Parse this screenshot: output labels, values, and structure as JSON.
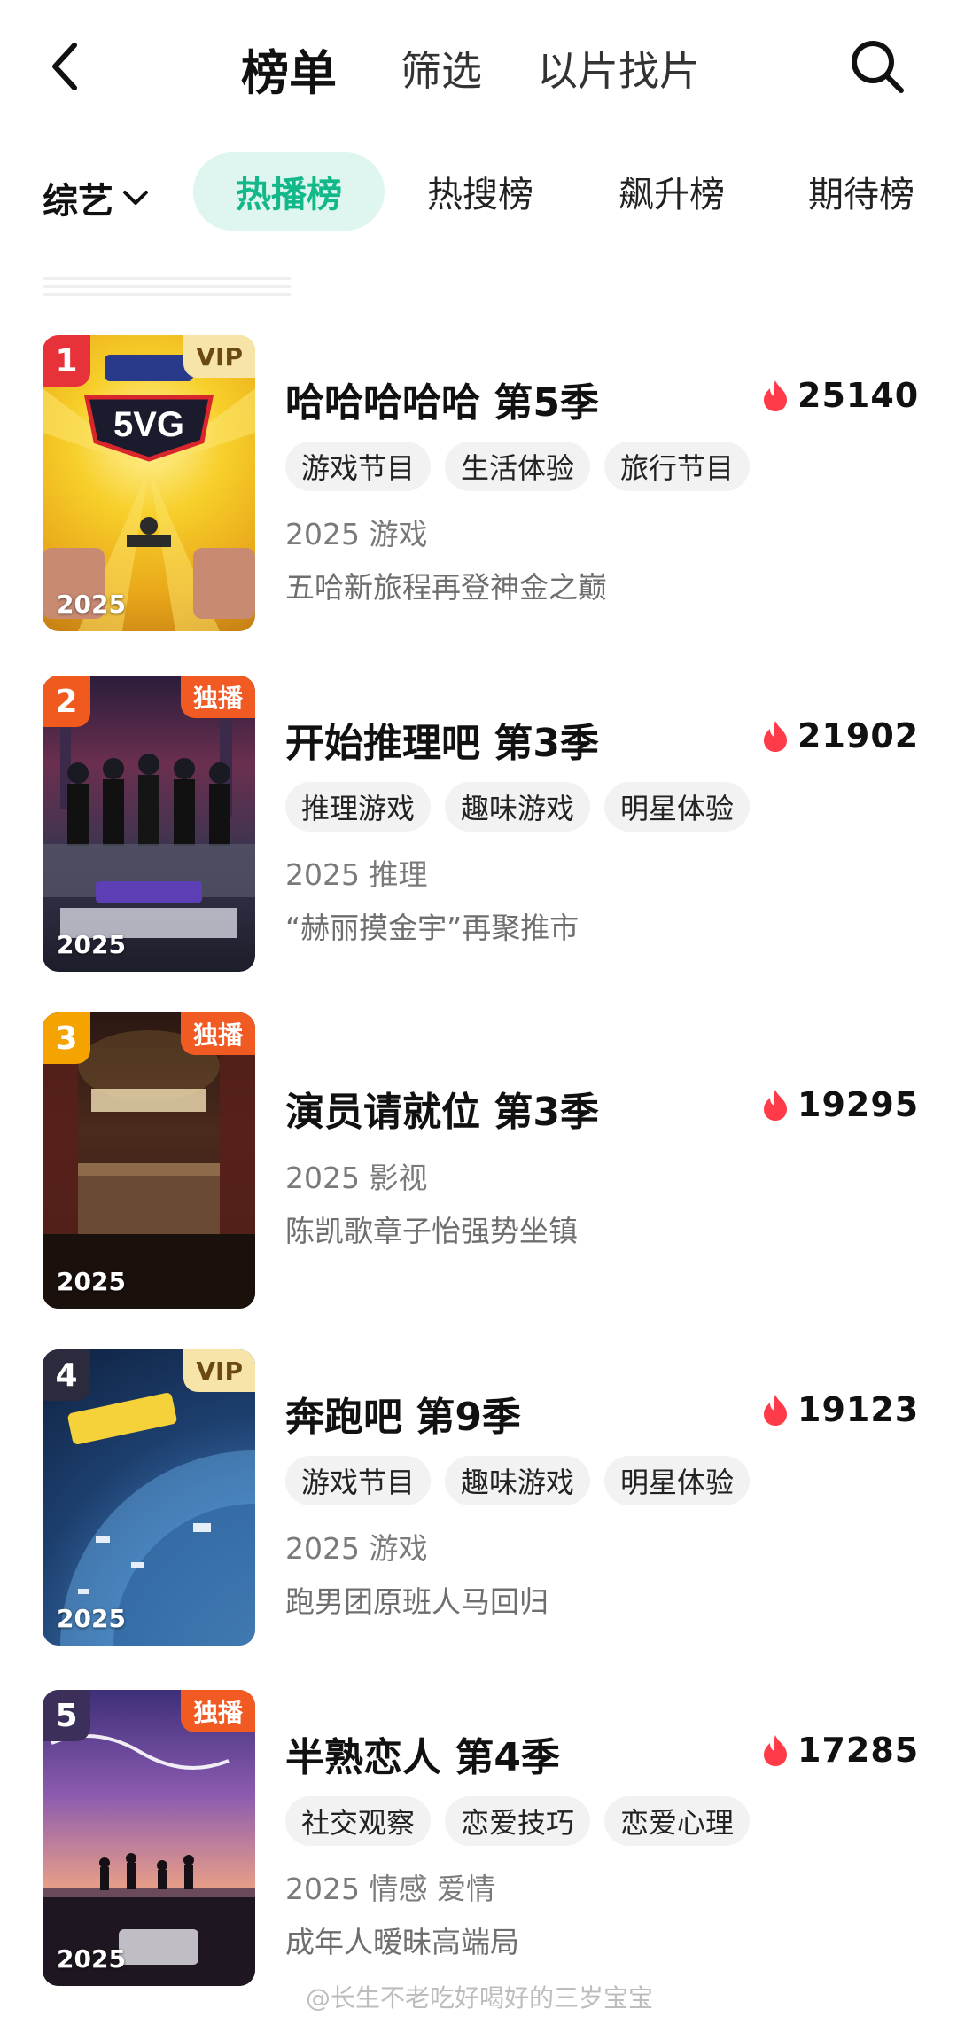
{
  "header": {
    "title": "榜单",
    "tabs": [
      "筛选",
      "以片找片"
    ]
  },
  "category": {
    "selected": "综艺",
    "tabs": [
      "热播榜",
      "热搜榜",
      "飙升榜",
      "期待榜"
    ],
    "active_tab": "热播榜"
  },
  "colors": {
    "accent": "#13b88a",
    "heat_icon": "#ff3b4a",
    "rank1": "#e8323a",
    "rank2": "#f05a1f",
    "rank3": "#f5a300",
    "rank4": "#2b2b3d",
    "rank5": "#3c2f5a"
  },
  "items": [
    {
      "rank": "1",
      "badge": "VIP",
      "badge_type": "vip",
      "year": "2025",
      "title": "哈哈哈哈哈 第5季",
      "heat": "25140",
      "tags": [
        "游戏节目",
        "生活体验",
        "旅行节目"
      ],
      "meta": "2025 游戏",
      "desc": "五哈新旅程再登神金之巅"
    },
    {
      "rank": "2",
      "badge": "独播",
      "badge_type": "exclusive",
      "year": "2025",
      "title": "开始推理吧 第3季",
      "heat": "21902",
      "tags": [
        "推理游戏",
        "趣味游戏",
        "明星体验"
      ],
      "meta": "2025 推理",
      "desc": "“赫丽摸金宇”再聚推市"
    },
    {
      "rank": "3",
      "badge": "独播",
      "badge_type": "exclusive",
      "year": "2025",
      "title": "演员请就位 第3季",
      "heat": "19295",
      "tags": [],
      "meta": "2025 影视",
      "desc": "陈凯歌章子怡强势坐镇"
    },
    {
      "rank": "4",
      "badge": "VIP",
      "badge_type": "vip",
      "year": "2025",
      "title": "奔跑吧 第9季",
      "heat": "19123",
      "tags": [
        "游戏节目",
        "趣味游戏",
        "明星体验"
      ],
      "meta": "2025 游戏",
      "desc": "跑男团原班人马回归"
    },
    {
      "rank": "5",
      "badge": "独播",
      "badge_type": "exclusive",
      "year": "2025",
      "title": "半熟恋人 第4季",
      "heat": "17285",
      "tags": [
        "社交观察",
        "恋爱技巧",
        "恋爱心理"
      ],
      "meta": "2025 情感 爱情",
      "desc": "成年人暧昧高端局"
    }
  ],
  "watermark": "@长生不老吃好喝好的三岁宝宝"
}
